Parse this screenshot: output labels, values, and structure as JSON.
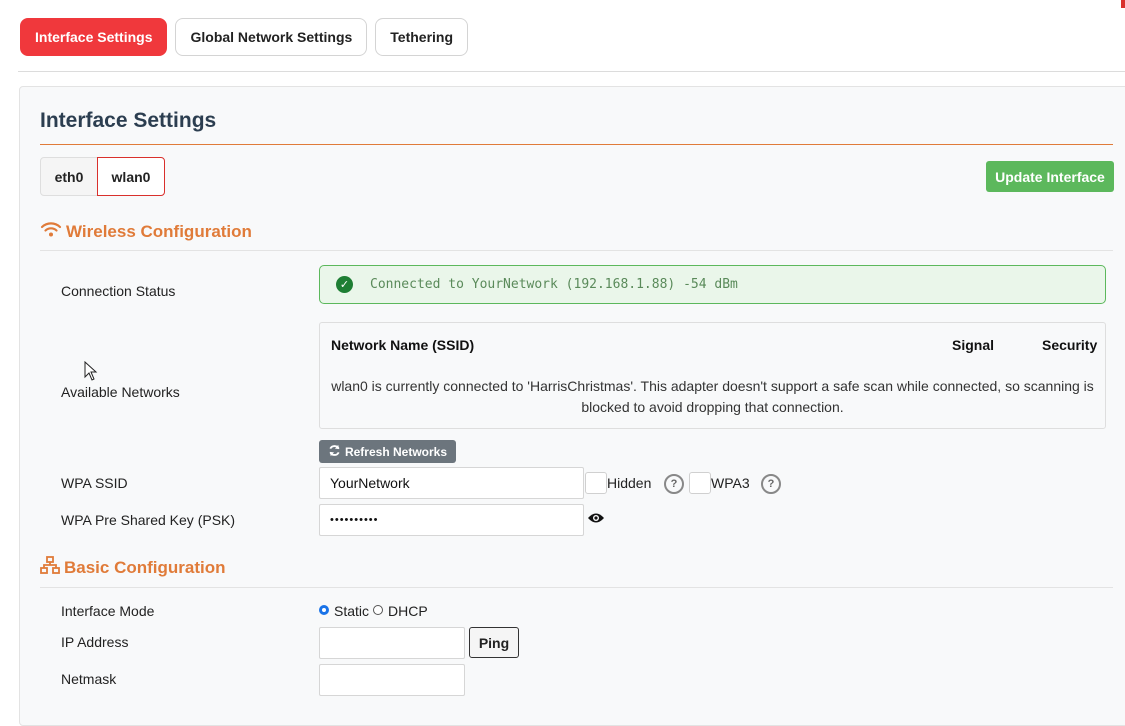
{
  "top_tabs": [
    {
      "label": "Interface Settings",
      "active": true
    },
    {
      "label": "Global Network Settings",
      "active": false
    },
    {
      "label": "Tethering",
      "active": false
    }
  ],
  "panel": {
    "title": "Interface Settings",
    "interfaces": [
      {
        "label": "eth0",
        "active": false
      },
      {
        "label": "wlan0",
        "active": true
      }
    ],
    "update_button": "Update Interface"
  },
  "wireless": {
    "heading": "Wireless Configuration",
    "heading_icon": "wifi-icon",
    "connection_status_label": "Connection Status",
    "connection_status_text": "Connected to YourNetwork (192.168.1.88) -54 dBm",
    "available_networks_label": "Available Networks",
    "networks_table": {
      "headers": [
        "Network Name (SSID)",
        "Signal",
        "Security"
      ],
      "message": "wlan0 is currently connected to 'HarrisChristmas'. This adapter doesn't support a safe scan while connected, so scanning is blocked to avoid dropping that connection."
    },
    "refresh_button": "Refresh Networks",
    "ssid_label": "WPA SSID",
    "ssid_value": "YourNetwork",
    "hidden_label": "Hidden",
    "wpa3_label": "WPA3",
    "psk_label": "WPA Pre Shared Key (PSK)",
    "psk_value": "••••••••••"
  },
  "basic": {
    "heading": "Basic Configuration",
    "heading_icon": "network-icon",
    "mode_label": "Interface Mode",
    "mode_options": [
      "Static",
      "DHCP"
    ],
    "mode_selected": "Static",
    "ip_label": "IP Address",
    "ip_value": "",
    "ping_button": "Ping",
    "netmask_label": "Netmask",
    "netmask_value": ""
  },
  "colors": {
    "active_tab": "#f0383c",
    "accent": "#e07b39",
    "success": "#5cb85c",
    "secondary_button": "#6c757d"
  }
}
